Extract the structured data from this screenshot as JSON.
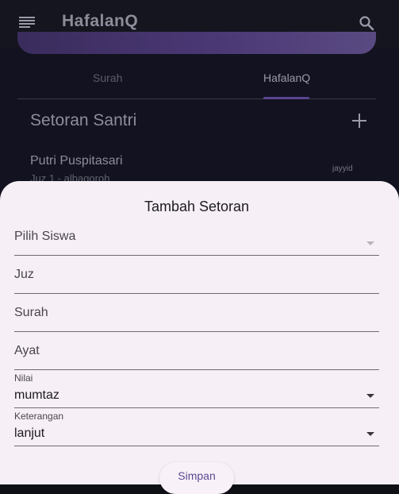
{
  "app": {
    "title": "HafalanQ",
    "tabs": [
      {
        "label": "Surah"
      },
      {
        "label": "HafalanQ"
      }
    ],
    "section_title": "Setoran Santri",
    "list": [
      {
        "name": "Putri Puspitasari",
        "subtitle": "Juz 1 - albaqoroh",
        "grade": "jayyid"
      }
    ]
  },
  "sheet": {
    "title": "Tambah Setoran",
    "fields": {
      "student": {
        "label": "Pilih Siswa"
      },
      "juz": {
        "label": "Juz"
      },
      "surah": {
        "label": "Surah"
      },
      "ayat": {
        "label": "Ayat"
      },
      "nilai": {
        "label": "Nilai",
        "value": "mumtaz"
      },
      "keterangan": {
        "label": "Keterangan",
        "value": "lanjut"
      }
    },
    "save_label": "Simpan"
  },
  "colors": {
    "sheet_background": "#f6eff6",
    "accent": "#5a4a90",
    "banner": "#4a3875"
  },
  "icons": [
    "menu-icon",
    "search-icon",
    "add-icon",
    "dropdown-arrow-icon"
  ]
}
